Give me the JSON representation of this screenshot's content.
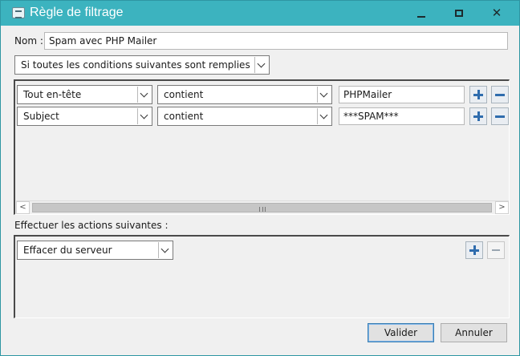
{
  "window": {
    "title": "Règle de filtrage",
    "buttons": {
      "minimize": "minimize",
      "maximize": "maximize",
      "close": "close"
    }
  },
  "name_field": {
    "label": "Nom :",
    "value": "Spam avec PHP Mailer"
  },
  "match_mode": {
    "value": "Si toutes les conditions suivantes sont remplies"
  },
  "conditions": [
    {
      "field": "Tout en-tête",
      "operator": "contient",
      "value": "PHPMailer"
    },
    {
      "field": "Subject",
      "operator": "contient",
      "value": "***SPAM***"
    }
  ],
  "actions_section": {
    "label": "Effectuer les actions suivantes :",
    "actions": [
      {
        "action": "Effacer du serveur"
      }
    ]
  },
  "footer": {
    "ok_label": "Valider",
    "cancel_label": "Annuler"
  },
  "colors": {
    "titlebar": "#3cb3bf",
    "accent": "#2f6cad",
    "dialog_bg": "#f0f0f0"
  }
}
